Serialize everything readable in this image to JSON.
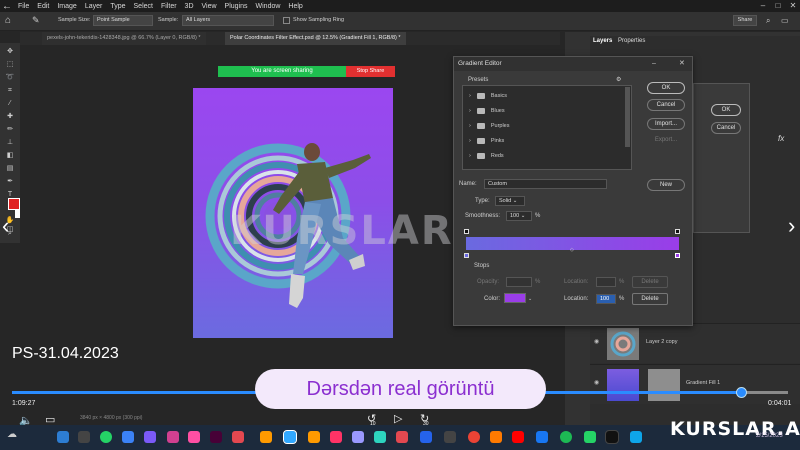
{
  "menu": {
    "items": [
      "File",
      "Edit",
      "Image",
      "Layer",
      "Type",
      "Select",
      "Filter",
      "3D",
      "View",
      "Plugins",
      "Window",
      "Help"
    ]
  },
  "options_bar": {
    "sample_size_label": "Sample Size:",
    "sample_size_value": "Point Sample",
    "sample_label": "Sample:",
    "sample_value": "All Layers",
    "show_ring_label": "Show Sampling Ring",
    "share_label": "Share"
  },
  "doc_tabs": [
    {
      "label": "pexels-john-tekeridis-1428348.jpg @ 66.7% (Layer 0, RGB/8) *"
    },
    {
      "label": "Polar Coordinates Filter Effect.psd @ 12.5% (Gradient Fill 1, RGB/8) *"
    }
  ],
  "screen_share": {
    "sharing_text": "You are screen sharing",
    "stop_label": "Stop Share"
  },
  "watermark_text": "KURSLAR.AZ",
  "gradient_editor": {
    "title": "Gradient Editor",
    "presets_label": "Presets",
    "presets": [
      "Basics",
      "Blues",
      "Purples",
      "Pinks",
      "Reds"
    ],
    "ok_label": "OK",
    "cancel_label": "Cancel",
    "import_label": "Import...",
    "export_label": "Export...",
    "name_label": "Name:",
    "name_value": "Custom",
    "new_label": "New",
    "type_label": "Type:",
    "type_value": "Solid",
    "smoothness_label": "Smoothness:",
    "smoothness_value": "100",
    "percent": "%",
    "stops_label": "Stops",
    "opacity_label": "Opacity:",
    "location_label": "Location:",
    "delete_label": "Delete",
    "color_label": "Color:",
    "color_location_value": "100",
    "color_swatch": "#9a3de8",
    "gradient_start": "#6a6ae0",
    "gradient_end": "#9a3de8"
  },
  "small_dialog": {
    "ok_label": "OK",
    "cancel_label": "Cancel"
  },
  "panels": {
    "layers_tab": "Layers",
    "properties_tab": "Properties",
    "fx_label": "fx"
  },
  "layers": [
    {
      "name": "Layer 2 copy"
    },
    {
      "name": "Gradient Fill 1"
    }
  ],
  "video": {
    "title": "PS-31.04.2023",
    "pill_text": "Dərsdən real görüntü",
    "time_current": "1:09:27",
    "time_total": "0:04:01",
    "progress": 0.94,
    "skip_back": "10",
    "skip_forward": "30"
  },
  "status_bar": {
    "doc_size": "3840 px × 4800 px (300 ppi)"
  },
  "brand": "KURSLAR.AZ",
  "clock_date": "2/15/2023",
  "colors": {
    "accent_blue": "#2a8cff",
    "foreground_color": "#e02020",
    "share_green": "#1fbf4f",
    "share_red": "#e23030"
  }
}
